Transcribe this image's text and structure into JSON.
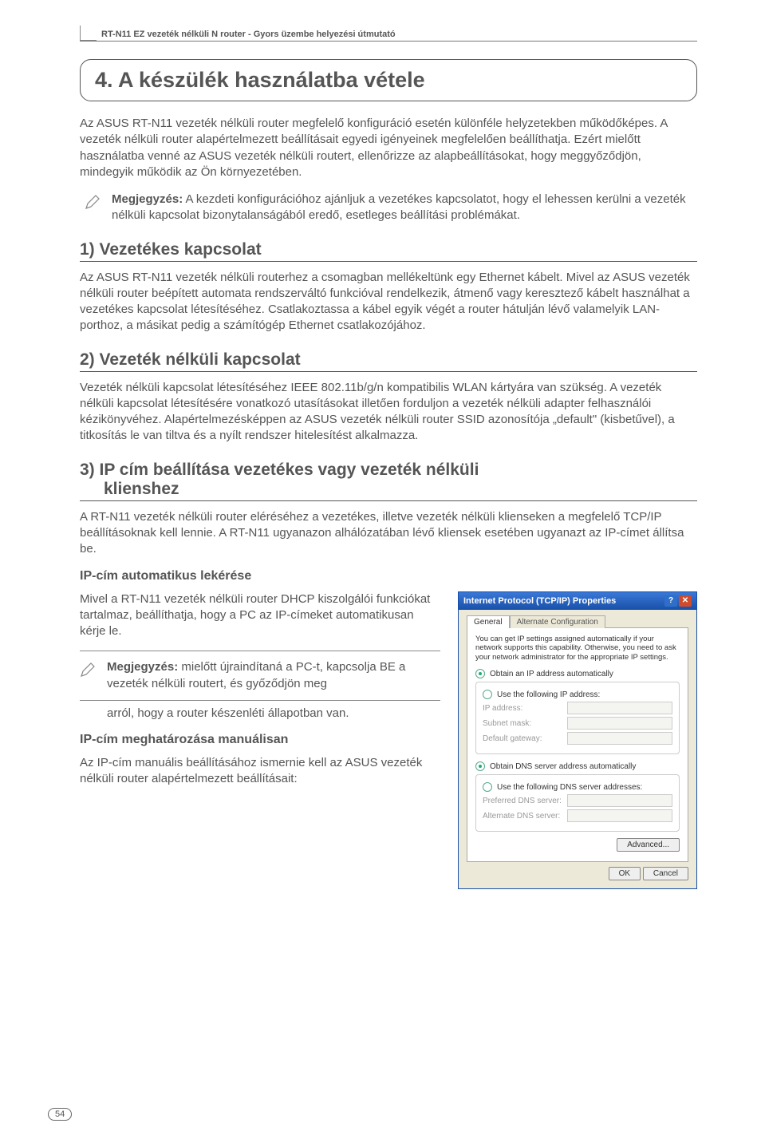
{
  "header": {
    "product_line": "RT-N11 EZ vezeték nélküli N router - Gyors üzembe helyezési útmutató"
  },
  "chapter": {
    "title": "4. A készülék használatba vétele"
  },
  "intro": "Az ASUS RT-N11 vezeték nélküli router megfelelő konfiguráció esetén különféle helyzetekben működőképes. A vezeték nélküli router alapértelmezett beállításait egyedi igényeinek megfelelően beállíthatja. Ezért mielőtt használatba venné az ASUS vezeték nélküli routert, ellenőrizze az alapbeállításokat, hogy meggyőződjön, mindegyik működik az Ön környezetében.",
  "note1": {
    "label": "Megjegyzés:",
    "text": " A kezdeti konfigurációhoz ajánljuk a vezetékes kapcsolatot, hogy el lehessen kerülni a vezeték nélküli kapcsolat bizonytalanságából eredő, esetleges beállítási problémákat."
  },
  "sec1": {
    "title": "1) Vezetékes kapcsolat",
    "body": "Az ASUS RT-N11 vezeték nélküli routerhez a csomagban mellékeltünk egy Ethernet kábelt. Mivel az ASUS vezeték nélküli router beépített automata rendszerváltó funkcióval rendelkezik, átmenő vagy keresztező kábelt használhat a vezetékes kapcsolat létesítéséhez. Csatlakoztassa a kábel egyik végét a router hátulján lévő valamelyik LAN-porthoz, a másikat pedig a számítógép Ethernet csatlakozójához."
  },
  "sec2": {
    "title": "2) Vezeték nélküli kapcsolat",
    "body": "Vezeték nélküli kapcsolat létesítéséhez IEEE 802.11b/g/n kompatibilis WLAN kártyára van szükség. A vezeték nélküli kapcsolat létesítésére vonatkozó utasításokat illetően forduljon a vezeték nélküli adapter felhasználói kézikönyvéhez. Alapértelmezésképpen az ASUS vezeték nélküli router SSID azonosítója „default\" (kisbetűvel), a titkosítás le van tiltva és a nyílt rendszer hitelesítést alkalmazza."
  },
  "sec3": {
    "title_line1": "3)  IP cím beállítása vezetékes vagy vezeték nélküli",
    "title_line2": "klienshez",
    "body": "A RT-N11 vezeték nélküli router eléréséhez a vezetékes, illetve vezeték nélküli klienseken a megfelelő TCP/IP beállításoknak kell lennie. A RT-N11 ugyanazon alhálózatában lévő kliensek esetében ugyanazt az IP-címet állítsa be."
  },
  "auto": {
    "heading": "IP-cím automatikus lekérése",
    "body": "Mivel a RT-N11 vezeték nélküli router DHCP kiszolgálói funkciókat tartalmaz, beállíthatja, hogy a PC az IP-címeket automatikusan kérje le."
  },
  "note2": {
    "label": "Megjegyzés:",
    "line1": " mielőtt újraindítaná a PC-t, kapcsolja BE a vezeték nélküli routert, és győződjön meg",
    "line2": "arról, hogy a router készenléti állapotban van."
  },
  "manual": {
    "heading": "IP-cím meghatározása manuálisan",
    "body": "Az IP-cím manuális beállításához ismernie kell az ASUS vezeték nélküli router alapértelmezett beállításait:"
  },
  "dialog": {
    "title": "Internet Protocol (TCP/IP) Properties",
    "tabs": {
      "general": "General",
      "alt": "Alternate Configuration"
    },
    "desc": "You can get IP settings assigned automatically if your network supports this capability. Otherwise, you need to ask your network administrator for the appropriate IP settings.",
    "r_ip_auto": "Obtain an IP address automatically",
    "r_ip_man": "Use the following IP address:",
    "f_ip": "IP address:",
    "f_mask": "Subnet mask:",
    "f_gw": "Default gateway:",
    "r_dns_auto": "Obtain DNS server address automatically",
    "r_dns_man": "Use the following DNS server addresses:",
    "f_pdns": "Preferred DNS server:",
    "f_adns": "Alternate DNS server:",
    "btn_adv": "Advanced...",
    "btn_ok": "OK",
    "btn_cancel": "Cancel"
  },
  "page_number": "54"
}
